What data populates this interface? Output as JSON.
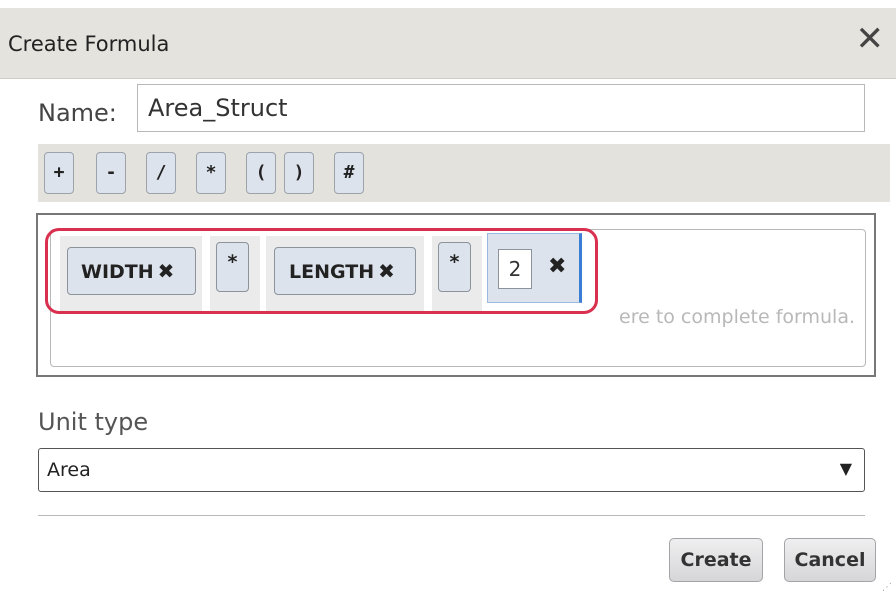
{
  "dialog": {
    "title": "Create Formula",
    "close_glyph": "✕"
  },
  "name_field": {
    "label": "Name:",
    "value": "Area_Struct"
  },
  "operators": [
    "+",
    "-",
    "/",
    "*",
    "(",
    ")",
    "#"
  ],
  "formula": {
    "placeholder": "ere to complete formula.",
    "tokens": [
      {
        "label": "WIDTH",
        "remove": "✖"
      },
      {
        "label": "*"
      },
      {
        "label": "LENGTH",
        "remove": "✖"
      },
      {
        "label": "*"
      }
    ],
    "number_value": "2",
    "number_remove": "✖"
  },
  "unit_type": {
    "label": "Unit type",
    "selected": "Area",
    "arrow": "▼"
  },
  "buttons": {
    "create": "Create",
    "cancel": "Cancel"
  },
  "colors": {
    "highlight": "#d8304e",
    "focus": "#3a7dd4",
    "chip_bg": "#dde3ec"
  }
}
